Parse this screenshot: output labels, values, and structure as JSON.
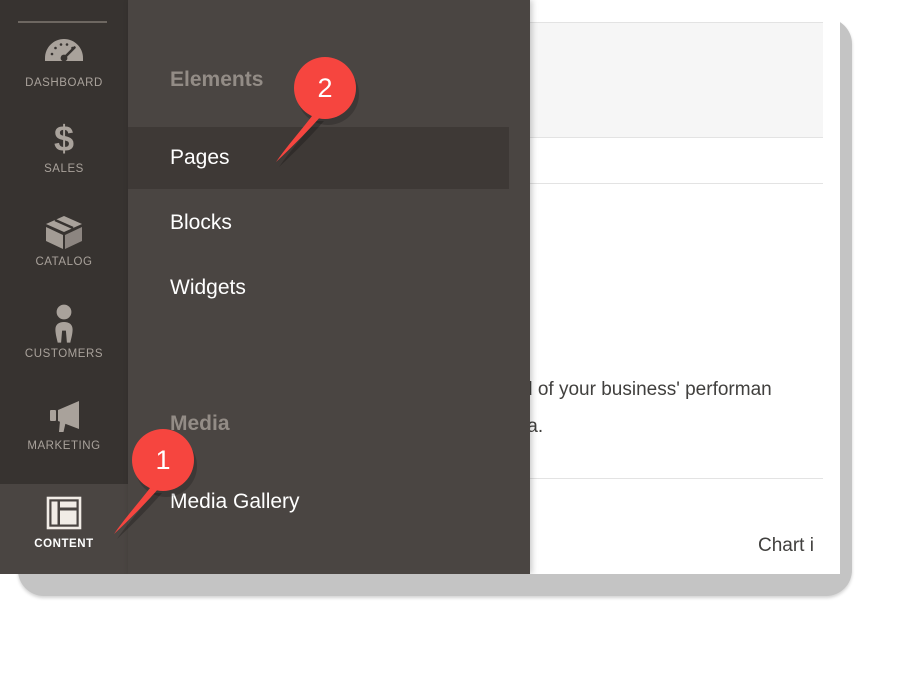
{
  "sidebar": {
    "items": [
      {
        "label": "DASHBOARD",
        "icon": "gauge-icon",
        "key": "dashboard",
        "active": false
      },
      {
        "label": "SALES",
        "icon": "dollar-icon",
        "key": "sales",
        "active": false
      },
      {
        "label": "CATALOG",
        "icon": "box-icon",
        "key": "catalog",
        "active": false
      },
      {
        "label": "CUSTOMERS",
        "icon": "person-icon",
        "key": "customers",
        "active": false
      },
      {
        "label": "MARKETING",
        "icon": "megaphone-icon",
        "key": "marketing",
        "active": false
      },
      {
        "label": "CONTENT",
        "icon": "layout-icon",
        "key": "content",
        "active": true
      }
    ]
  },
  "flyout": {
    "groups": [
      {
        "heading": "Elements",
        "items": [
          {
            "label": "Pages",
            "selected": true
          },
          {
            "label": "Blocks",
            "selected": false
          },
          {
            "label": "Widgets",
            "selected": false
          }
        ]
      },
      {
        "heading": "Media",
        "items": [
          {
            "label": "Media Gallery",
            "selected": false
          }
        ]
      }
    ]
  },
  "content": {
    "paragraph_line_1": "d of your business' performan",
    "paragraph_line_2": "ta.",
    "chart_note": "Chart i"
  },
  "callouts": [
    {
      "number": "1",
      "target": "sidebar-item-content"
    },
    {
      "number": "2",
      "target": "flyout-item-pages"
    }
  ],
  "colors": {
    "sidebar_bg": "#373330",
    "sidebar_active_bg": "#4a4542",
    "flyout_bg": "#4a4542",
    "flyout_selected_bg": "#3e3936",
    "callout_red": "#f6453f",
    "frame_gray": "#c4c4c4",
    "label_gray": "#a9a29b",
    "heading_gray": "#938c86"
  }
}
